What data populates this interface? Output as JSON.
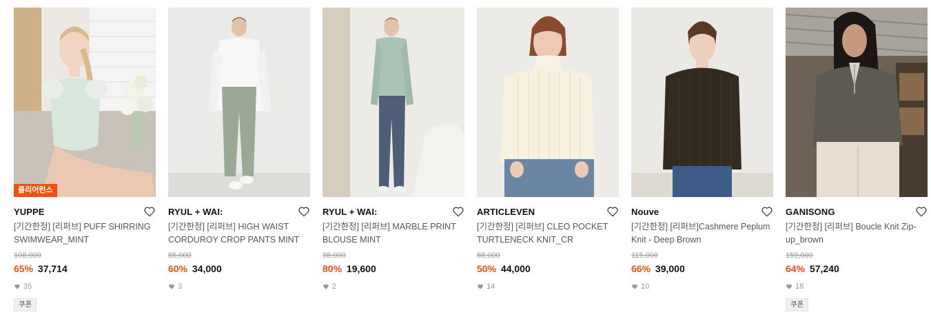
{
  "products": [
    {
      "brand": "YUPPE",
      "title": "[기간한정] [리퍼브] PUFF SHIRRING SWIMWEAR_MINT",
      "original_price": "108,000",
      "discount": "65%",
      "price": "37,714",
      "likes": "35",
      "badge": "클리어런스",
      "coupon": "쿠폰"
    },
    {
      "brand": "RYUL + WAI:",
      "title": "[기간한정] [리퍼브] HIGH WAIST CORDUROY CROP PANTS MINT",
      "original_price": "85,000",
      "discount": "60%",
      "price": "34,000",
      "likes": "3"
    },
    {
      "brand": "RYUL + WAI:",
      "title": "[기간한정] [리퍼브] MARBLE PRINT BLOUSE MINT",
      "original_price": "98,000",
      "discount": "80%",
      "price": "19,600",
      "likes": "2"
    },
    {
      "brand": "ARTICLEVEN",
      "title": "[기간한정] [리퍼브] CLEO POCKET TURTLENECK KNIT_CR",
      "original_price": "88,000",
      "discount": "50%",
      "price": "44,000",
      "likes": "14"
    },
    {
      "brand": "Nouve",
      "title": "[기간한정] [리퍼브]Cashmere Peplum Knit - Deep Brown",
      "original_price": "115,000",
      "discount": "66%",
      "price": "39,000",
      "likes": "10"
    },
    {
      "brand": "GANISONG",
      "title": "[기간한정] [리퍼브] Boucle Knit Zip-up_brown",
      "original_price": "159,000",
      "discount": "64%",
      "price": "57,240",
      "likes": "18",
      "coupon": "쿠폰"
    }
  ],
  "colors": {
    "accent": "#f2500f",
    "muted": "#999999"
  }
}
